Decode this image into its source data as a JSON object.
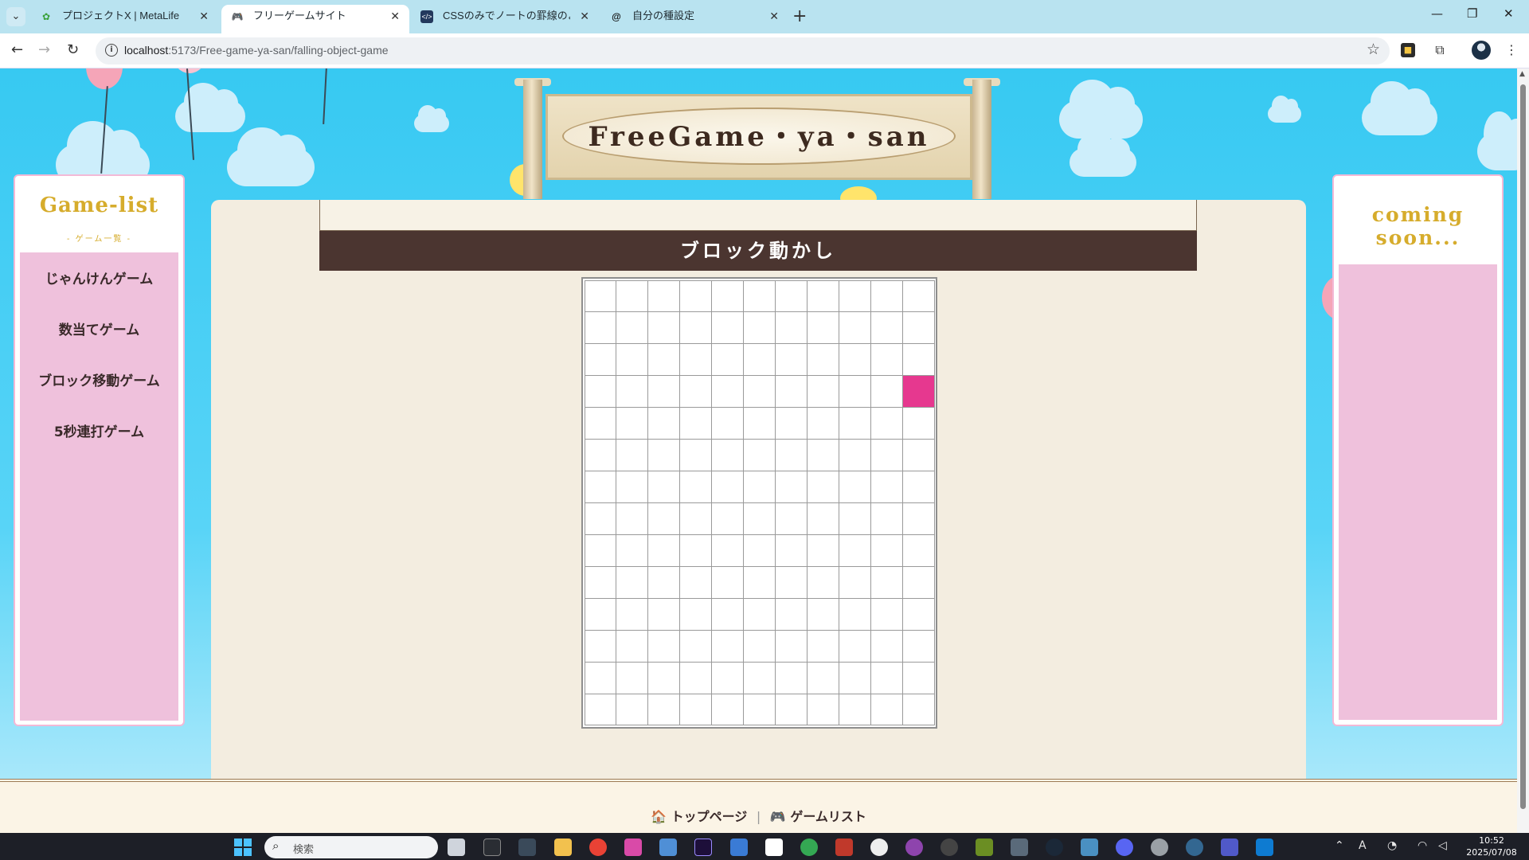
{
  "browser": {
    "tabs": [
      {
        "title": "プロジェクトX | MetaLife",
        "icon": "metalife-leaf-icon",
        "active": false
      },
      {
        "title": "フリーゲームサイト",
        "icon": "gamepad-icon",
        "active": true
      },
      {
        "title": "CSSのみでノートの罫線のようなスタ",
        "icon": "code-icon",
        "active": false
      },
      {
        "title": "自分の種設定",
        "icon": "threads-icon",
        "active": false
      }
    ],
    "url_host": "localhost",
    "url_path": ":5173/Free-game-ya-san/falling-object-game",
    "colors": {
      "tabbar": "#b9e3f0",
      "active_tab": "#ffffff"
    }
  },
  "site": {
    "sign_title": "FreeGame・ya・san",
    "game_title": "ブロック動かし",
    "left_panel": {
      "title": "Game-list",
      "subtitle": "- ゲーム一覧 -",
      "items": [
        "じゃんけんゲーム",
        "数当てゲーム",
        "ブロック移動ゲーム",
        "5秒連打ゲーム"
      ]
    },
    "right_panel": {
      "title_line1": "coming",
      "title_line2": "soon..."
    },
    "grid": {
      "columns": 11,
      "rows": 14,
      "active_cell": {
        "row": 4,
        "col": 11
      }
    },
    "footer": {
      "home_icon": "🏠",
      "home_label": "トップページ",
      "separator": "|",
      "list_icon": "🎮",
      "list_label": "ゲームリスト"
    },
    "colors": {
      "sky": "#37c9f2",
      "header_bar": "#4b3530",
      "active_block": "#e6388f",
      "panel_pink": "#efc1dc",
      "title_gold": "#d6ac2c"
    }
  },
  "taskbar": {
    "search_placeholder": "検索",
    "time": "10:52",
    "date": "2025/07/08"
  }
}
